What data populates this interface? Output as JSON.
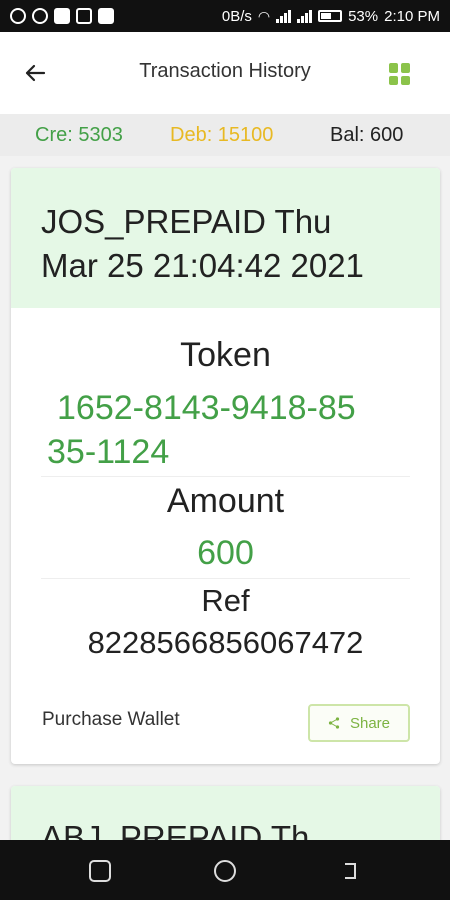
{
  "status_bar": {
    "network_speed": "0B/s",
    "battery_percent": "53%",
    "time": "2:10 PM"
  },
  "app_bar": {
    "title": "Transaction History",
    "back_icon": "arrow-left-icon",
    "menu_icon": "grid-icon"
  },
  "summary": {
    "credit": "Cre: 5303",
    "debit": "Deb: 15100",
    "balance": "Bal: 600",
    "colors": {
      "credit": "#43a047",
      "debit": "#e8b923",
      "balance": "#222222"
    }
  },
  "transactions": [
    {
      "header_line1": "JOS_PREPAID Thu",
      "header_line2": "Mar 25 21:04:42 2021",
      "token_label": "Token",
      "token_line1": "1652-8143-9418-85",
      "token_line2": "35-1124",
      "amount_label": "Amount",
      "amount": "600",
      "ref_label": "Ref",
      "ref": "8228566856067472",
      "wallet": "Purchase Wallet",
      "share_label": "Share",
      "share_icon": "share-icon"
    },
    {
      "header_line1": "ABJ_PREPAID Th"
    }
  ],
  "theme": {
    "accent": "#43a047",
    "header_bg": "#e5f8e6"
  }
}
